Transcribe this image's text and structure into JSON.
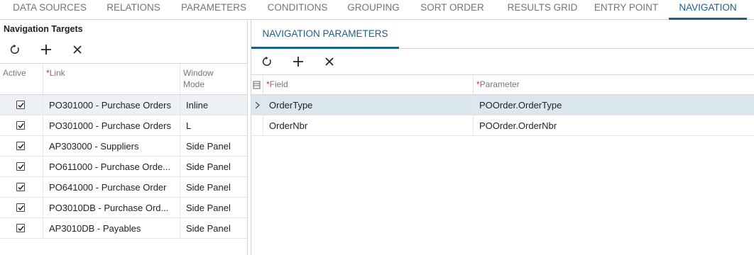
{
  "tabs": [
    {
      "label": "DATA SOURCES"
    },
    {
      "label": "RELATIONS"
    },
    {
      "label": "PARAMETERS"
    },
    {
      "label": "CONDITIONS"
    },
    {
      "label": "GROUPING"
    },
    {
      "label": "SORT ORDER"
    },
    {
      "label": "RESULTS GRID"
    },
    {
      "label": "ENTRY POINT"
    },
    {
      "label": "NAVIGATION"
    }
  ],
  "active_tab": "NAVIGATION",
  "accent_color": "#1c5f8a",
  "left_panel": {
    "title": "Navigation Targets",
    "toolbar": [
      "refresh-icon",
      "add-icon",
      "delete-icon"
    ],
    "columns": {
      "active": "Active",
      "link": "Link",
      "window_mode": "Window Mode"
    },
    "rows": [
      {
        "active": true,
        "link": "PO301000 - Purchase Orders",
        "window_mode": "Inline"
      },
      {
        "active": true,
        "link": "PO301000 - Purchase Orders",
        "window_mode": "L"
      },
      {
        "active": true,
        "link": "AP303000 - Suppliers",
        "window_mode": "Side Panel"
      },
      {
        "active": true,
        "link": "PO611000 - Purchase Orde...",
        "window_mode": "Side Panel"
      },
      {
        "active": true,
        "link": "PO641000 - Purchase Order",
        "window_mode": "Side Panel"
      },
      {
        "active": true,
        "link": "PO3010DB - Purchase Ord...",
        "window_mode": "Side Panel"
      },
      {
        "active": true,
        "link": "AP3010DB - Payables",
        "window_mode": "Side Panel"
      }
    ]
  },
  "right_panel": {
    "subtab": "NAVIGATION PARAMETERS",
    "toolbar": [
      "refresh-icon",
      "add-icon",
      "delete-icon"
    ],
    "columns": {
      "field": "Field",
      "parameter": "Parameter"
    },
    "rows": [
      {
        "field": "OrderType",
        "parameter": "POOrder.OrderType"
      },
      {
        "field": "OrderNbr",
        "parameter": "POOrder.OrderNbr"
      }
    ]
  }
}
